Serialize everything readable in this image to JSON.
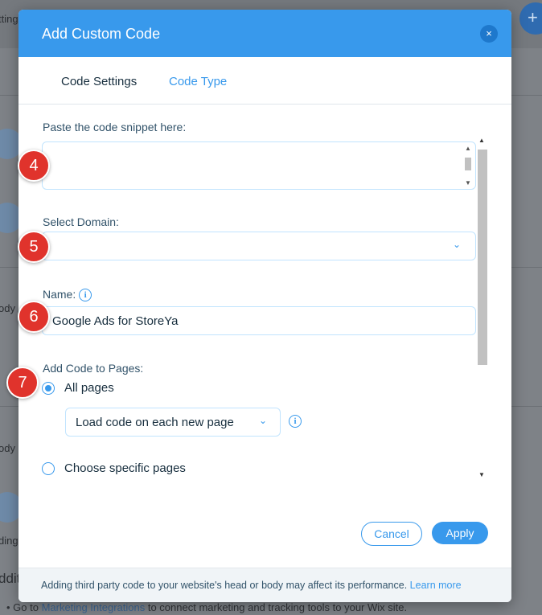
{
  "background": {
    "top_text": "ttings",
    "side_text_1": "ody",
    "side_text_2": "ody",
    "side_text_3": "ding",
    "side_text_4": "dditi",
    "bullet_prefix": "Go to",
    "bullet_link": "Marketing Integrations",
    "bullet_suffix": "to connect marketing and tracking tools to your Wix site.",
    "plus_label": "+"
  },
  "modal": {
    "title": "Add Custom Code",
    "close_label": "×",
    "tabs": [
      {
        "label": "Code Settings"
      },
      {
        "label": "Code Type"
      }
    ],
    "snippet_label": "Paste the code snippet here:",
    "domain_label": "Select Domain:",
    "name_label": "Name:",
    "name_value": "Google Ads for StoreYa",
    "pages_label": "Add Code to Pages:",
    "all_pages_label": "All pages",
    "load_option": "Load code on each new page",
    "specific_pages_label": "Choose specific pages",
    "info_glyph": "i",
    "chevron": "⌄",
    "cancel_label": "Cancel",
    "apply_label": "Apply",
    "footer_text": "Adding third party code to your website's head or body may affect its performance.",
    "footer_link": "Learn more"
  },
  "badges": [
    "4",
    "5",
    "6",
    "7"
  ],
  "colors": {
    "accent": "#3899ec",
    "badge": "#e0332c"
  }
}
